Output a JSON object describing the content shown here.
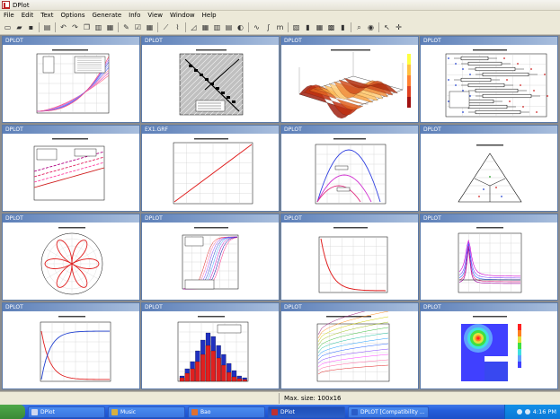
{
  "window": {
    "title": "DPlot"
  },
  "menu": [
    "File",
    "Edit",
    "Text",
    "Options",
    "Generate",
    "Info",
    "View",
    "Window",
    "Help"
  ],
  "toolbar": [
    {
      "name": "new-doc-icon",
      "glyph": "▭"
    },
    {
      "name": "open-folder-icon",
      "glyph": "▰"
    },
    {
      "name": "save-icon",
      "glyph": "▪"
    },
    {
      "name": "sep"
    },
    {
      "name": "print-icon",
      "glyph": "▤"
    },
    {
      "name": "sep"
    },
    {
      "name": "undo-icon",
      "glyph": "↶"
    },
    {
      "name": "redo-icon",
      "glyph": "↷"
    },
    {
      "name": "copy-icon",
      "glyph": "❐"
    },
    {
      "name": "paste-icon",
      "glyph": "▥"
    },
    {
      "name": "clipboard-icon",
      "glyph": "▦"
    },
    {
      "name": "sep"
    },
    {
      "name": "edit-data-icon",
      "glyph": "✎"
    },
    {
      "name": "check-icon",
      "glyph": "☑"
    },
    {
      "name": "tile-icon",
      "glyph": "▦"
    },
    {
      "name": "sep"
    },
    {
      "name": "line-tool-icon",
      "glyph": "⟋"
    },
    {
      "name": "curve-tool-icon",
      "glyph": "⌇"
    },
    {
      "name": "sep"
    },
    {
      "name": "chart-linear-icon",
      "glyph": "◿"
    },
    {
      "name": "chart-grid-icon",
      "glyph": "▦"
    },
    {
      "name": "chart-bar-icon",
      "glyph": "▥"
    },
    {
      "name": "chart-area-icon",
      "glyph": "▤"
    },
    {
      "name": "chart-polar-icon",
      "glyph": "◐"
    },
    {
      "name": "sep"
    },
    {
      "name": "smooth-curve-icon",
      "glyph": "∿"
    },
    {
      "name": "integral-icon",
      "glyph": "∫"
    },
    {
      "name": "m-label-icon",
      "glyph": "m"
    },
    {
      "name": "sep"
    },
    {
      "name": "image-icon",
      "glyph": "▧"
    },
    {
      "name": "histogram-icon",
      "glyph": "▮"
    },
    {
      "name": "table-icon",
      "glyph": "▦"
    },
    {
      "name": "grid-view-icon",
      "glyph": "▩"
    },
    {
      "name": "bars-icon",
      "glyph": "▮"
    },
    {
      "name": "sep"
    },
    {
      "name": "zoom-icon",
      "glyph": "⌕"
    },
    {
      "name": "eye-icon",
      "glyph": "◉"
    },
    {
      "name": "sep"
    },
    {
      "name": "pointer-help-icon",
      "glyph": "↖"
    },
    {
      "name": "crosshair-icon",
      "glyph": "✛"
    }
  ],
  "colors": {
    "accent": "#5c7fb8",
    "taskbar": "#245edb",
    "start": "#3a8a36"
  },
  "docs": [
    {
      "title": "DPLOT",
      "type": "curves"
    },
    {
      "title": "DPLOT",
      "type": "diag"
    },
    {
      "title": "DPLOT",
      "type": "surface"
    },
    {
      "title": "DPLOT",
      "type": "boxplot"
    },
    {
      "title": "DPLOT",
      "type": "multiline"
    },
    {
      "title": "EX1.GRF",
      "type": "straight"
    },
    {
      "title": "DPLOT",
      "type": "projectile"
    },
    {
      "title": "DPLOT",
      "type": "ternary"
    },
    {
      "title": "DPLOT",
      "type": "polar"
    },
    {
      "title": "DPLOT",
      "type": "dense"
    },
    {
      "title": "DPLOT",
      "type": "decay"
    },
    {
      "title": "DPLOT",
      "type": "resonance"
    },
    {
      "title": "DPLOT",
      "type": "crossing"
    },
    {
      "title": "DPLOT",
      "type": "histogram"
    },
    {
      "title": "DPLOT",
      "type": "family"
    },
    {
      "title": "DPLOT",
      "type": "contour"
    }
  ],
  "status": {
    "text": "Max. size: 100x16"
  },
  "taskbar": {
    "buttons": [
      {
        "label": "DPlot",
        "color": "#d0d8f0",
        "active": false,
        "width": 86
      },
      {
        "label": "Music",
        "color": "#d8b040",
        "active": false,
        "width": 86
      },
      {
        "label": "Bao",
        "color": "#e07030",
        "active": false,
        "width": 86
      },
      {
        "label": "DPlot",
        "color": "#c03030",
        "active": true,
        "width": 86
      },
      {
        "label": "DPLOT [Compatibility ...",
        "color": "#2a5cc8",
        "active": false,
        "width": 90
      }
    ],
    "clock": "4:16 PM"
  }
}
